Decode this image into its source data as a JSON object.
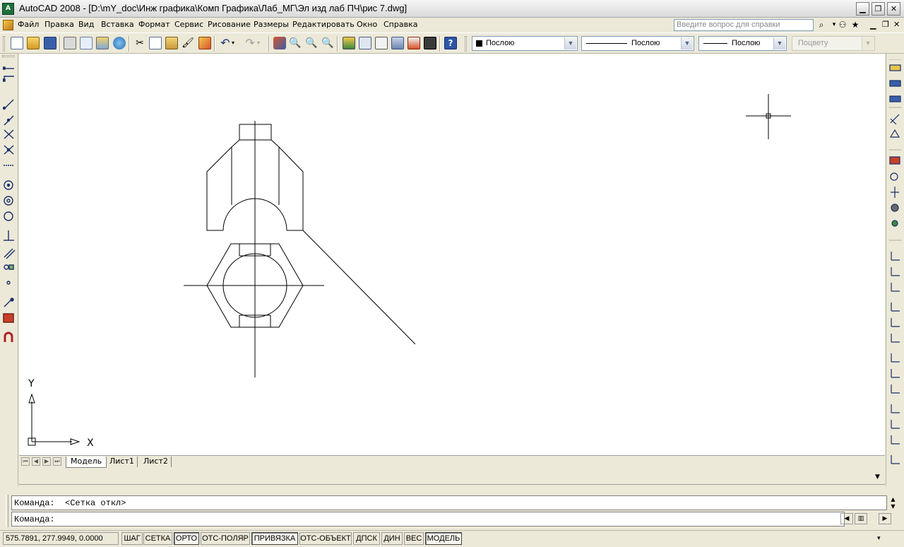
{
  "window": {
    "app_icon": "A",
    "title": "AutoCAD 2008 - [D:\\mY_doc\\Инж графика\\Комп Графика\\Лаб_МГ\\Эл изд лаб ПЧ\\рис 7.dwg]",
    "minimize_icon": "minimize-icon",
    "maximize_icon": "restore-icon",
    "close_icon": "close-icon"
  },
  "menu": {
    "items": [
      "Файл",
      "Правка",
      "Вид",
      "Вставка",
      "Формат",
      "Сервис",
      "Рисование",
      "Размеры",
      "Редактировать",
      "Окно",
      "Справка"
    ],
    "help_placeholder": "Введите вопрос для справки"
  },
  "toolbar": {
    "color_combo": "Послою",
    "linetype_combo": "Послою",
    "lineweight_combo": "Послою",
    "plotstyle_combo": "Поцвету"
  },
  "tabs": {
    "items": [
      "Модель",
      "Лист1",
      "Лист2"
    ],
    "active": "Модель"
  },
  "ucs": {
    "x_label": "X",
    "y_label": "Y"
  },
  "command": {
    "history": "Команда:  <Сетка откл>",
    "prompt": "Команда:"
  },
  "status": {
    "coords": "575.7891, 277.9949, 0.0000",
    "buttons": [
      {
        "label": "ШАГ",
        "on": false
      },
      {
        "label": "СЕТКА",
        "on": false
      },
      {
        "label": "ОРТО",
        "on": true
      },
      {
        "label": "ОТС-ПОЛЯР",
        "on": false
      },
      {
        "label": "ПРИВЯЗКА",
        "on": true
      },
      {
        "label": "ОТС-ОБЪЕКТ",
        "on": false
      },
      {
        "label": "ДПСК",
        "on": false
      },
      {
        "label": "ДИН",
        "on": false
      },
      {
        "label": "ВЕС",
        "on": false
      },
      {
        "label": "МОДЕЛЬ",
        "on": true
      }
    ]
  },
  "colors": {
    "background": "#ece9d8",
    "canvas": "#ffffff",
    "drawing_line": "#000000"
  }
}
